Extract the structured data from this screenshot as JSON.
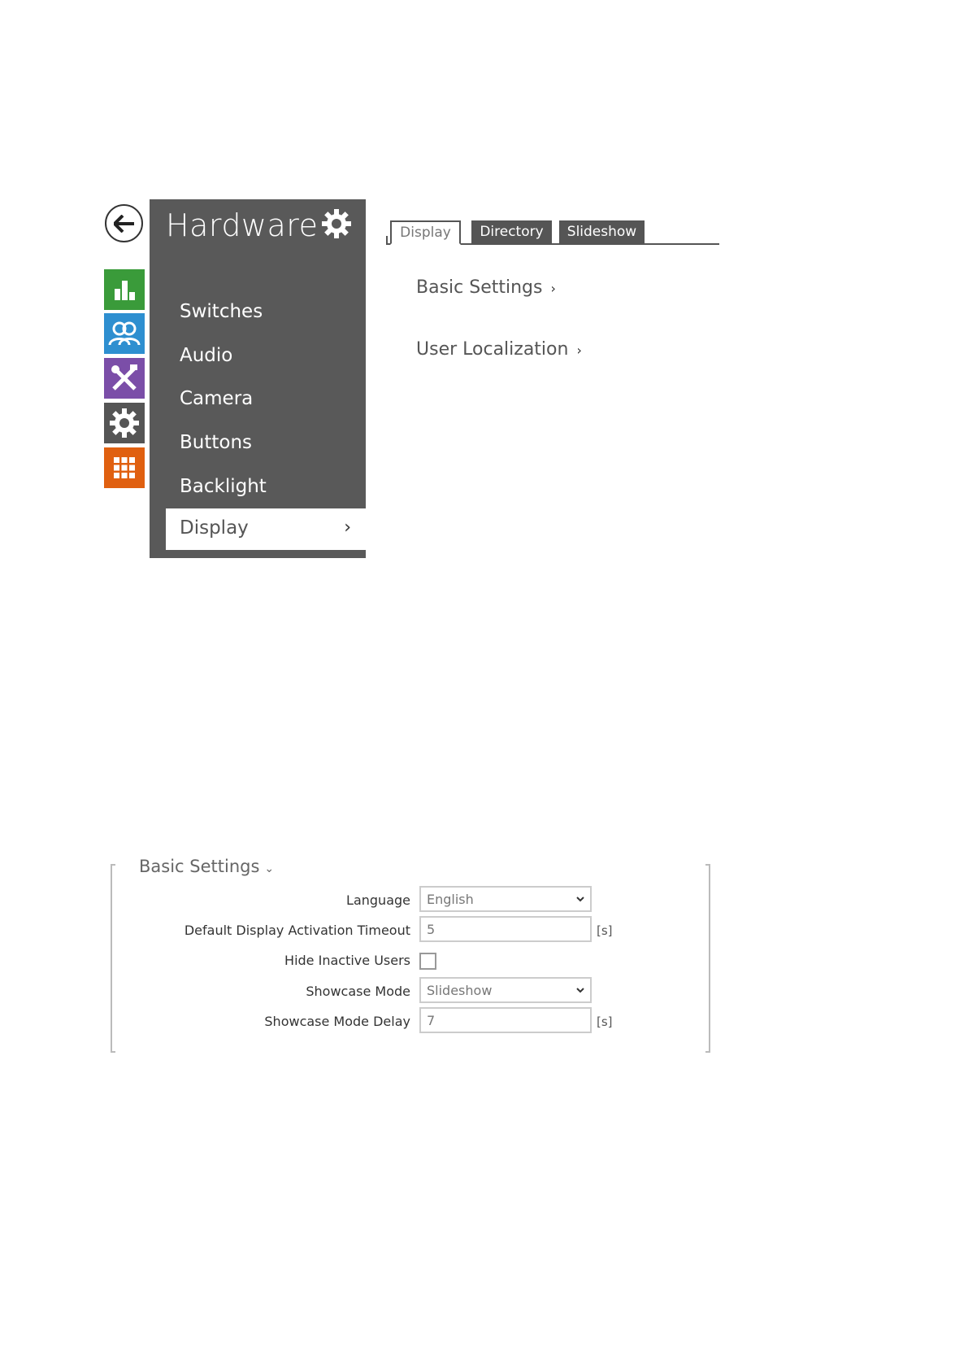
{
  "menu": {
    "title": "Hardware",
    "items": [
      "Switches",
      "Audio",
      "Camera",
      "Buttons",
      "Backlight",
      "Display"
    ],
    "active_index": 5
  },
  "rail": {
    "icons": [
      {
        "name": "status-chart-icon",
        "color": "#3a9b3a"
      },
      {
        "name": "directory-users-icon",
        "color": "#2e8fd0"
      },
      {
        "name": "hardware-tools-icon",
        "color": "#7b4ea8"
      },
      {
        "name": "system-gear-icon",
        "color": "#555555"
      },
      {
        "name": "services-grid-icon",
        "color": "#e06010"
      }
    ]
  },
  "tabs": [
    "Display",
    "Directory",
    "Slideshow"
  ],
  "links": {
    "basic_settings": "Basic Settings",
    "user_localization": "User Localization"
  },
  "panel": {
    "title": "Basic Settings",
    "language_label": "Language",
    "language_value": "English",
    "timeout_label": "Default Display Activation Timeout",
    "timeout_value": "5",
    "timeout_unit": "[s]",
    "hide_label": "Hide Inactive Users",
    "hide_checked": false,
    "showcase_label": "Showcase Mode",
    "showcase_value": "Slideshow",
    "delay_label": "Showcase Mode Delay",
    "delay_value": "7",
    "delay_unit": "[s]"
  }
}
